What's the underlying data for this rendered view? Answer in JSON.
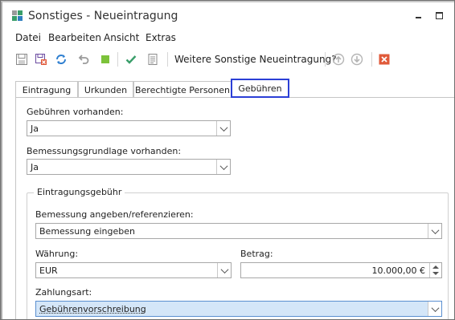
{
  "window": {
    "title": "Sonstiges - Neueintragung"
  },
  "menu": {
    "items": [
      "Datei",
      "Bearbeiten",
      "Ansicht",
      "Extras"
    ]
  },
  "toolbar": {
    "question_label": "Weitere Sonstige Neueintragung?",
    "icons": [
      "save-icon",
      "save-close-icon",
      "refresh-icon",
      "undo-icon",
      "stop-icon",
      "confirm-check-icon",
      "document-icon",
      "arrow-up-icon",
      "arrow-down-icon",
      "close-red-icon"
    ]
  },
  "tabs": [
    {
      "label": "Eintragung"
    },
    {
      "label": "Urkunden"
    },
    {
      "label": "Berechtigte Personen"
    },
    {
      "label": "Gebühren",
      "active": true
    }
  ],
  "form": {
    "gebuehren_label": "Gebühren vorhanden:",
    "gebuehren_value": "Ja",
    "bemessungsgrundlage_label": "Bemessungsgrundlage vorhanden:",
    "bemessungsgrundlage_value": "Ja",
    "group_title": "Eintragungsgebühr",
    "bemessung_label": "Bemessung angeben/referenzieren:",
    "bemessung_value": "Bemessung eingeben",
    "waehrung_label": "Währung:",
    "waehrung_value": "EUR",
    "betrag_label": "Betrag:",
    "betrag_value": "10.000,00 €",
    "zahlungsart_label": "Zahlungsart:",
    "zahlungsart_value": "Gebührenvorschreibung"
  },
  "colors": {
    "active_tab_border": "#2b3fd6",
    "highlight_field": "#d4e6f8",
    "stop_green": "#7cc23a",
    "close_red": "#e05a3a",
    "refresh_blue": "#2f7fd0"
  }
}
